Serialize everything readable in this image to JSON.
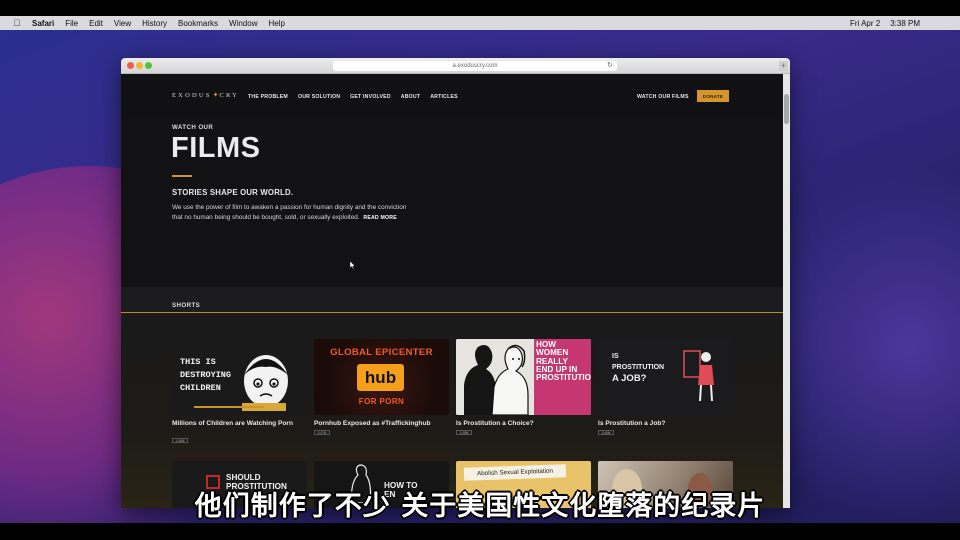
{
  "menubar": {
    "app": "Safari",
    "items": [
      "File",
      "Edit",
      "View",
      "History",
      "Bookmarks",
      "Window",
      "Help"
    ],
    "date": "Fri Apr 2",
    "time": "3:38 PM"
  },
  "browser": {
    "url": "a.exodusсry.com"
  },
  "site": {
    "logo_left": "EXODUS",
    "logo_right": "CRY",
    "nav": [
      "THE PROBLEM",
      "OUR SOLUTION",
      "GET INVOLVED",
      "ABOUT",
      "ARTICLES"
    ],
    "watch_link": "WATCH OUR FILMS",
    "donate": "DONATE"
  },
  "hero": {
    "eyebrow": "WATCH OUR",
    "title": "FILMS",
    "subtitle": "STORIES SHAPE OUR WORLD.",
    "body": "We use the power of film to awaken a passion for human dignity and the conviction that no human being should be bought, sold, or sexually exploited.",
    "read_more": "READ MORE"
  },
  "shorts": {
    "label": "SHORTS",
    "cards": [
      {
        "title": "Millions of Children are Watching Porn",
        "badge": "1:46M",
        "thumb_text": [
          "THIS IS",
          "DESTROYING",
          "CHILDREN"
        ]
      },
      {
        "title": "Pornhub Exposed as #Traffickinghub",
        "badge": "2:47M",
        "thumb_text": [
          "GLOBAL EPICENTER",
          "hub",
          "FOR PORN"
        ]
      },
      {
        "title": "Is Prostitution a Choice?",
        "badge": "3:38M",
        "thumb_text": [
          "HOW",
          "WOMEN",
          "REALLY",
          "END UP IN",
          "PROSTITUTION"
        ]
      },
      {
        "title": "Is Prostitution a Job?",
        "badge": "3:46M",
        "thumb_text": [
          "IS",
          "PROSTITUTION",
          "A JOB?"
        ]
      }
    ],
    "row2": [
      {
        "thumb_text": [
          "SHOULD",
          "PROSTITUTION"
        ]
      },
      {
        "thumb_text": [
          "HOW TO",
          "EN"
        ]
      },
      {
        "thumb_text": [
          "Abolish Sexual Exploitation"
        ]
      },
      {
        "thumb_text": []
      }
    ]
  },
  "caption": "他们制作了不少 关于美国性文化堕落的纪录片"
}
